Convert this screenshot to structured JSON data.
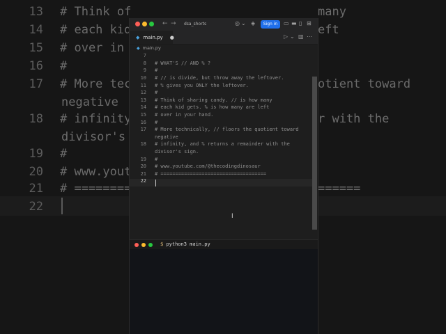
{
  "background": {
    "lines": [
      {
        "num": "13",
        "text": "# Think of",
        "tail": "many"
      },
      {
        "num": "14",
        "text": "# each kid",
        "tail": "eft"
      },
      {
        "num": "15",
        "text": "# over in",
        "tail": ""
      },
      {
        "num": "16",
        "text": "#",
        "tail": ""
      },
      {
        "num": "17",
        "text": "# More tech",
        "tail": "otient toward"
      },
      {
        "num": "",
        "text": "negative",
        "tail": ""
      },
      {
        "num": "18",
        "text": "# infinity",
        "tail": "r with the"
      },
      {
        "num": "",
        "text": "divisor's",
        "tail": ""
      },
      {
        "num": "19",
        "text": "#",
        "tail": ""
      },
      {
        "num": "20",
        "text": "# www.yout",
        "tail": ""
      },
      {
        "num": "21",
        "text": "# ========",
        "tail": "======"
      },
      {
        "num": "22",
        "text": "",
        "tail": ""
      }
    ]
  },
  "titlebar": {
    "search": "dsa_shorts",
    "sign_in": "Sign in",
    "colors": {
      "close": "#ff5f57",
      "minimize": "#febc2e",
      "maximize": "#28c840",
      "accent": "#1f6feb"
    }
  },
  "tab": {
    "filename": "main.py",
    "modified": "●"
  },
  "breadcrumb": {
    "filename": "main.py"
  },
  "code": {
    "lines": [
      {
        "num": "7",
        "text": ""
      },
      {
        "num": "8",
        "text": "# WHAT'S // AND % ?"
      },
      {
        "num": "9",
        "text": "#"
      },
      {
        "num": "10",
        "text": "# // is divide, but throw away the leftover."
      },
      {
        "num": "11",
        "text": "# % gives you ONLY the leftover."
      },
      {
        "num": "12",
        "text": "#"
      },
      {
        "num": "13",
        "text": "# Think of sharing candy. // is how many"
      },
      {
        "num": "14",
        "text": "# each kid gets. % is how many are left"
      },
      {
        "num": "15",
        "text": "# over in your hand."
      },
      {
        "num": "16",
        "text": "#"
      },
      {
        "num": "17",
        "text": "# More technically, // floors the quotient toward"
      },
      {
        "num": "",
        "text": "negative"
      },
      {
        "num": "18",
        "text": "# infinity, and % returns a remainder with the"
      },
      {
        "num": "",
        "text": "divisor's sign."
      },
      {
        "num": "19",
        "text": "#"
      },
      {
        "num": "20",
        "text": "# www.youtube.com/@thecodingdinosaur"
      },
      {
        "num": "21",
        "text": "# ===================================="
      },
      {
        "num": "22",
        "text": ""
      }
    ]
  },
  "terminal": {
    "prompt_symbol": "$",
    "command": "python3 main.py"
  }
}
